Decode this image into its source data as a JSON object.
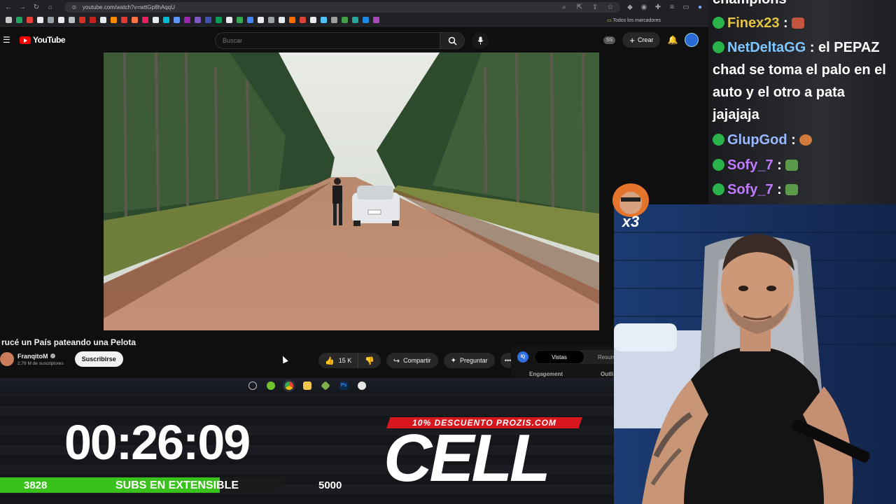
{
  "browser": {
    "url": "youtube.com/watch?v=wttGp8hAqqU",
    "bookmarks_folder": "Todos los marcadores"
  },
  "youtube": {
    "logo_text": "YouTube",
    "search_placeholder": "Buscar",
    "ss_badge": "SS",
    "create_label": "Crear",
    "video_title": "rucé un País pateando una Pelota",
    "channel_name": "FranqitoM",
    "channel_subs": "2,79 M de suscriptores",
    "subscribe_label": "Suscribirse",
    "like_count": "15 K",
    "share_label": "Compartir",
    "ask_label": "Preguntar",
    "panel": {
      "badge": "IQ",
      "tab_active": "Vistas",
      "tab_other": "Resum",
      "label_1": "Engagement",
      "label_2": "Outli"
    }
  },
  "overlay": {
    "timer": "00:26:09",
    "subs_current": "3828",
    "subs_label": "SUBS EN EXTENSIBLE",
    "subs_goal": "5000",
    "subs_progress": 0.766,
    "promo": "10% DESCUENTO PROZIS.COM",
    "brand": "CELL"
  },
  "chat": {
    "top_partial": "champions",
    "messages": [
      {
        "user": "Finex23",
        "sep": ":",
        "text": ""
      },
      {
        "user": "NetDeltaGG",
        "sep": ":",
        "text": "el PEPAZ chad se toma el palo en el auto y el otro a pata jajajaja"
      },
      {
        "user": "GlupGod",
        "sep": ":",
        "text": ""
      },
      {
        "user": "Sofy_7",
        "sep": ":",
        "text": ""
      },
      {
        "user": "Sofy_7",
        "sep": ":",
        "text": ""
      }
    ]
  },
  "sticker_text": "x3",
  "colors": {
    "yt_red": "#ff0000",
    "subs_green": "#39c21c",
    "promo_red": "#d7161d"
  }
}
